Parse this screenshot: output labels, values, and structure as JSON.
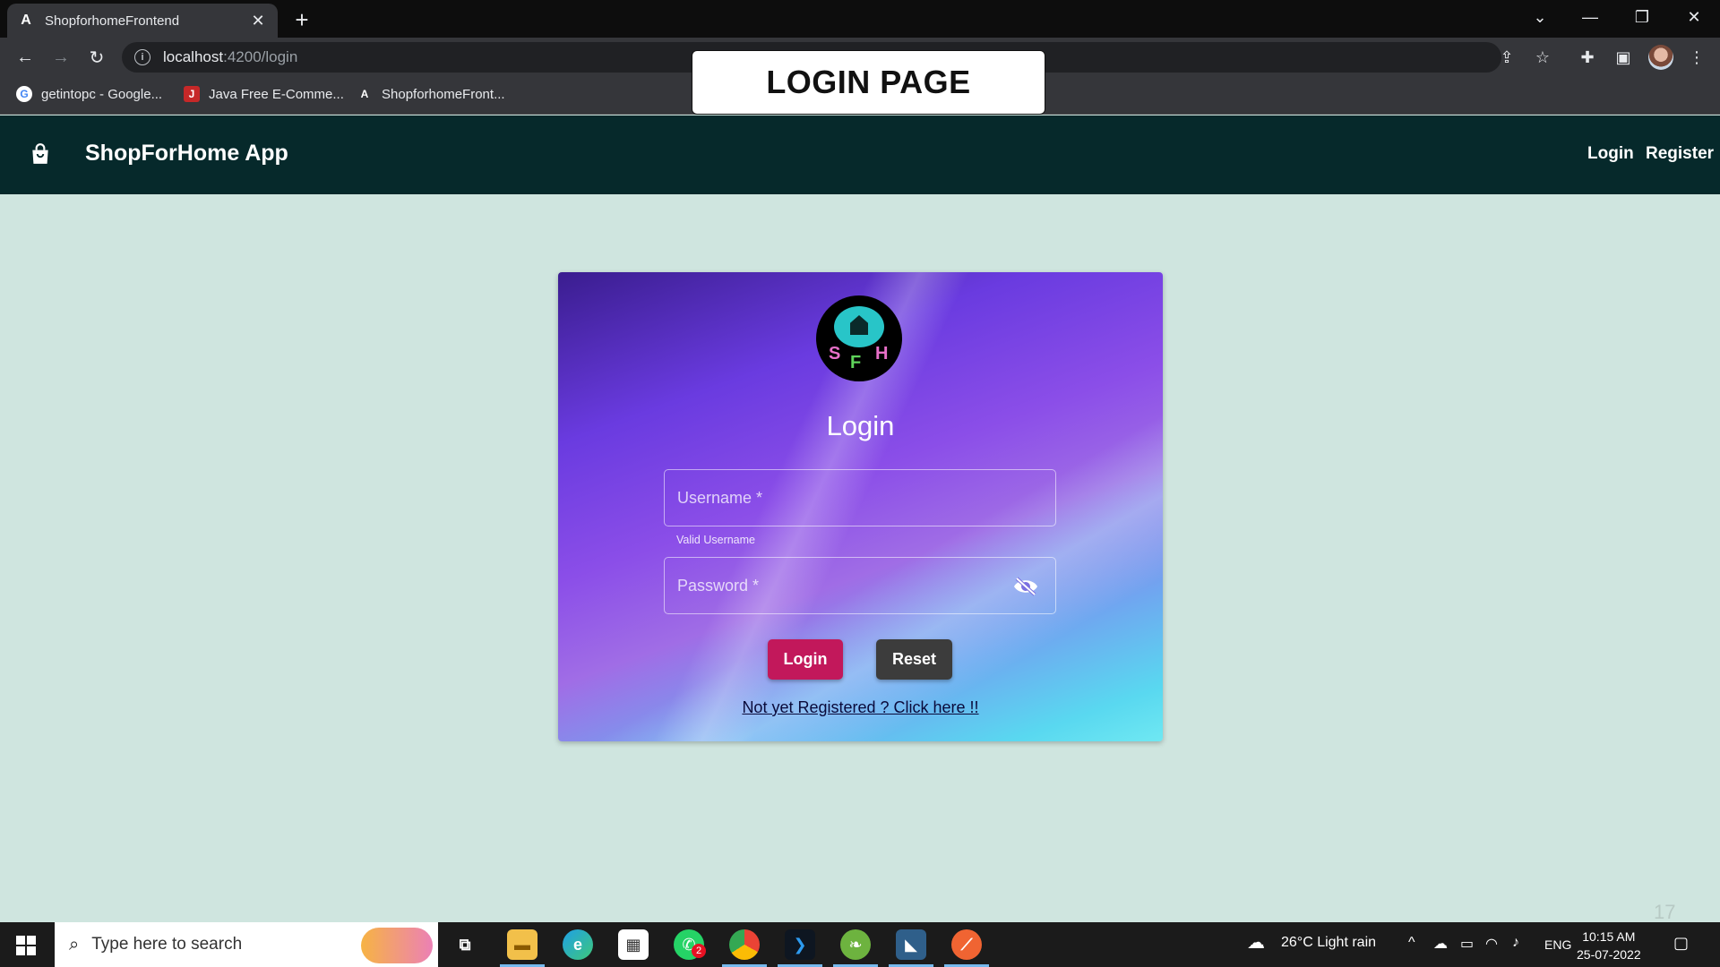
{
  "browser": {
    "tab_title": "ShopforhomeFrontend",
    "url_host": "localhost",
    "url_path": ":4200/login",
    "bookmarks": [
      "getintopc - Google...",
      "Java Free E-Comme...",
      "ShopforhomeFront..."
    ]
  },
  "overlay_label": "LOGIN PAGE",
  "app": {
    "brand": "ShopForHome App",
    "nav": {
      "login": "Login",
      "register": "Register"
    }
  },
  "login": {
    "logo_letters": [
      "S",
      "F",
      "H"
    ],
    "title": "Login",
    "username_placeholder": "Username *",
    "username_hint": "Valid Username",
    "password_placeholder": "Password *",
    "login_button": "Login",
    "reset_button": "Reset",
    "register_link": "Not yet Registered ? Click here !!"
  },
  "page_number": "17",
  "taskbar": {
    "search_placeholder": "Type here to search",
    "weather": "26°C  Light rain",
    "language": "ENG",
    "time": "10:15 AM",
    "date": "25-07-2022",
    "whatsapp_badge": "2"
  }
}
